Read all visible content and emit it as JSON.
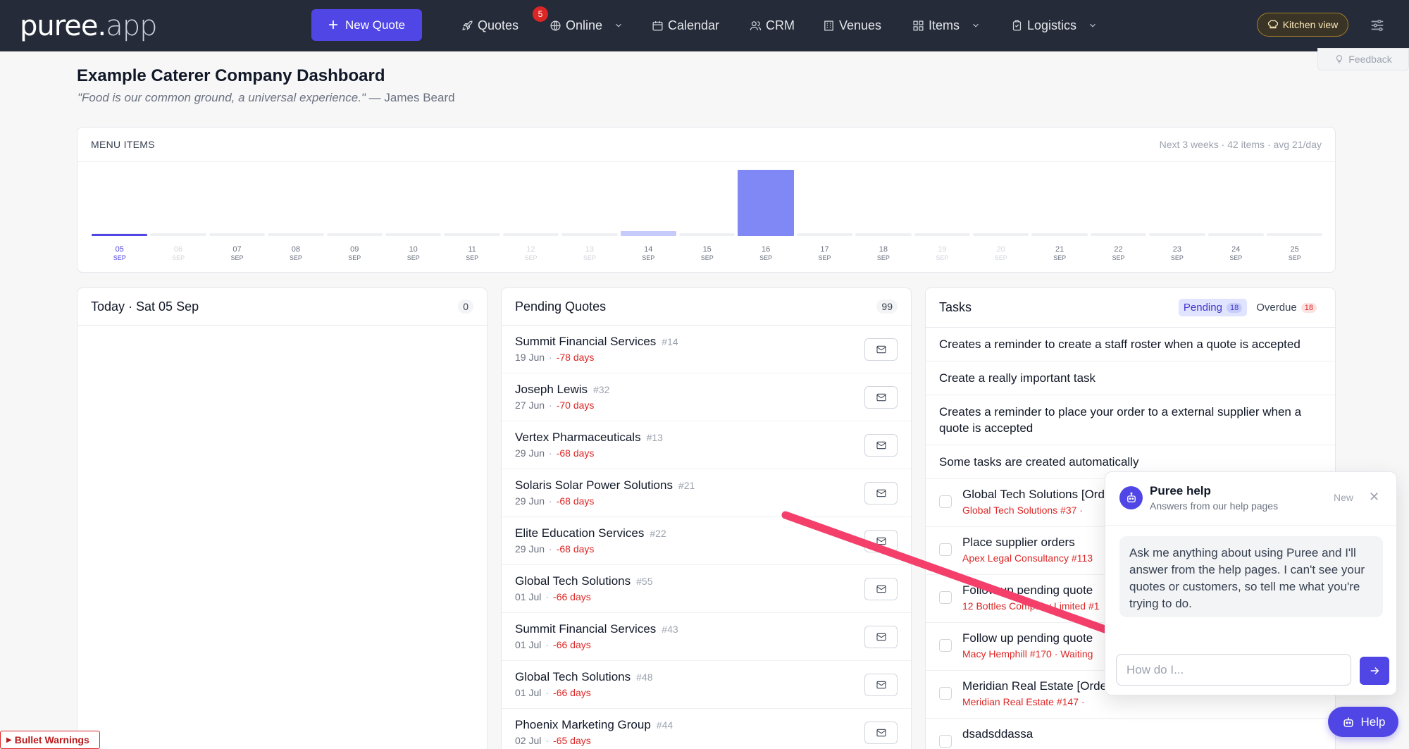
{
  "nav": {
    "logo_main": "puree",
    "logo_dot": ".",
    "logo_app": "app",
    "new_quote": "New Quote",
    "items": [
      {
        "label": "Quotes",
        "icon": "rocket-icon"
      },
      {
        "label": "Online",
        "icon": "globe-icon"
      },
      {
        "label": "Calendar",
        "icon": "calendar-icon"
      },
      {
        "label": "CRM",
        "icon": "users-icon"
      },
      {
        "label": "Venues",
        "icon": "building-icon"
      },
      {
        "label": "Items",
        "icon": "grid-icon"
      },
      {
        "label": "Logistics",
        "icon": "clipboard-icon"
      }
    ],
    "quotes_badge": "5",
    "kitchen_view": "Kitchen view"
  },
  "feedback": "Feedback",
  "page": {
    "title": "Example Caterer Company Dashboard",
    "quote_text": "\"Food is our common ground, a universal experience.\"",
    "quote_author": " — James Beard"
  },
  "chart": {
    "title": "MENU ITEMS",
    "meta": "Next 3 weeks · 42 items · avg 21/day",
    "colors": {
      "bar": "#8088f5",
      "today": "#5046e5"
    }
  },
  "chart_data": {
    "type": "bar",
    "categories": [
      "05 SEP",
      "06 SEP",
      "07 SEP",
      "08 SEP",
      "09 SEP",
      "10 SEP",
      "11 SEP",
      "12 SEP",
      "13 SEP",
      "14 SEP",
      "15 SEP",
      "16 SEP",
      "17 SEP",
      "18 SEP",
      "19 SEP",
      "20 SEP",
      "21 SEP",
      "22 SEP",
      "23 SEP",
      "24 SEP",
      "25 SEP"
    ],
    "days": [
      "05",
      "06",
      "07",
      "08",
      "09",
      "10",
      "11",
      "12",
      "13",
      "14",
      "15",
      "16",
      "17",
      "18",
      "19",
      "20",
      "21",
      "22",
      "23",
      "24",
      "25"
    ],
    "month": "SEP",
    "values": [
      0,
      0,
      0,
      0,
      0,
      0,
      0,
      0,
      0,
      2,
      0,
      40,
      0,
      0,
      0,
      0,
      0,
      0,
      0,
      0,
      0
    ],
    "dim": [
      false,
      true,
      false,
      false,
      false,
      false,
      false,
      true,
      true,
      false,
      false,
      false,
      false,
      false,
      true,
      true,
      false,
      false,
      false,
      false,
      false
    ],
    "today_index": 0,
    "ylim": [
      0,
      40
    ]
  },
  "today": {
    "title": "Today · Sat 05 Sep",
    "count": "0"
  },
  "pending": {
    "title": "Pending Quotes",
    "count": "99",
    "rows": [
      {
        "name": "Summit Financial Services",
        "num": "#14",
        "date": "19 Jun",
        "days": "-78 days"
      },
      {
        "name": "Joseph Lewis",
        "num": "#32",
        "date": "27 Jun",
        "days": "-70 days"
      },
      {
        "name": "Vertex Pharmaceuticals",
        "num": "#13",
        "date": "29 Jun",
        "days": "-68 days"
      },
      {
        "name": "Solaris Solar Power Solutions",
        "num": "#21",
        "date": "29 Jun",
        "days": "-68 days"
      },
      {
        "name": "Elite Education Services",
        "num": "#22",
        "date": "29 Jun",
        "days": "-68 days"
      },
      {
        "name": "Global Tech Solutions",
        "num": "#55",
        "date": "01 Jul",
        "days": "-66 days"
      },
      {
        "name": "Summit Financial Services",
        "num": "#43",
        "date": "01 Jul",
        "days": "-66 days"
      },
      {
        "name": "Global Tech Solutions",
        "num": "#48",
        "date": "01 Jul",
        "days": "-66 days"
      },
      {
        "name": "Phoenix Marketing Group",
        "num": "#44",
        "date": "02 Jul",
        "days": "-65 days"
      }
    ]
  },
  "tasks": {
    "title": "Tasks",
    "tab_pending": "Pending",
    "tab_pending_count": "18",
    "tab_overdue": "Overdue",
    "tab_overdue_count": "18",
    "info_rows": [
      "Creates a reminder to create a staff roster when a quote is accepted",
      "Create a really important task",
      "Creates a reminder to place your order to a external supplier when a quote is accepted",
      "Some tasks are created automatically"
    ],
    "rows": [
      {
        "name": "Global Tech Solutions [Ord",
        "sub": "Global Tech Solutions #37 ·"
      },
      {
        "name": "Place supplier orders",
        "sub": "Apex Legal Consultancy #113"
      },
      {
        "name": "Follow up pending quote",
        "sub": "12 Bottles Company Limited #1"
      },
      {
        "name": "Follow up pending quote",
        "sub": "Macy Hemphill #170 · Waiting"
      },
      {
        "name": "Meridian Real Estate [Orde",
        "sub": "Meridian Real Estate #147 ·"
      },
      {
        "name": "dsadsddassa",
        "sub": ""
      }
    ]
  },
  "help": {
    "title": "Puree help",
    "subtitle": "Answers from our help pages",
    "new": "New",
    "close": "✕",
    "message": "Ask me anything about using Puree and I'll answer from the help pages. I can't see your quotes or customers, so tell me what you're trying to do.",
    "placeholder": "How do I...",
    "fab_label": "Help"
  },
  "bullet_warnings": "Bullet Warnings",
  "annotation": {
    "arrow_color": "#f43f6b"
  }
}
